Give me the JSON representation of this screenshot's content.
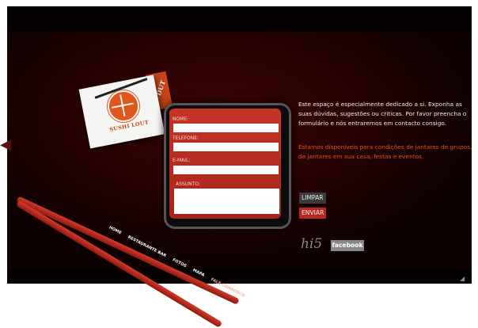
{
  "logo": {
    "brand": "SUSHI LOUT",
    "tab_text": "DUT"
  },
  "form": {
    "nome_label": "NOME:",
    "telefone_label": "TELEFONE:",
    "email_label": "E-MAIL:",
    "assunto_label": "ASSUNTO:"
  },
  "info": {
    "intro": "Este espaço é especialmente dedicado a si. Exponha as suas dúvidas, sugestões ou criticas. Por favor preencha o formulário e nós entraremos em contacto consigo.",
    "note": "Estamos disponíveis para condições de jantares de grupos, de jantares em sua casa, festas e eventos."
  },
  "buttons": {
    "limpar": "LIMPAR",
    "enviar": "ENVIAR"
  },
  "social": {
    "hi5": "hi5",
    "facebook": "facebook"
  },
  "nav": {
    "items": [
      "HOME",
      "RESTAURANTE BAR",
      "FOTOS",
      "MAPA",
      "FALE CONNOSCO"
    ]
  },
  "colors": {
    "accent": "#d9531f",
    "panel": "#b52a1e"
  }
}
